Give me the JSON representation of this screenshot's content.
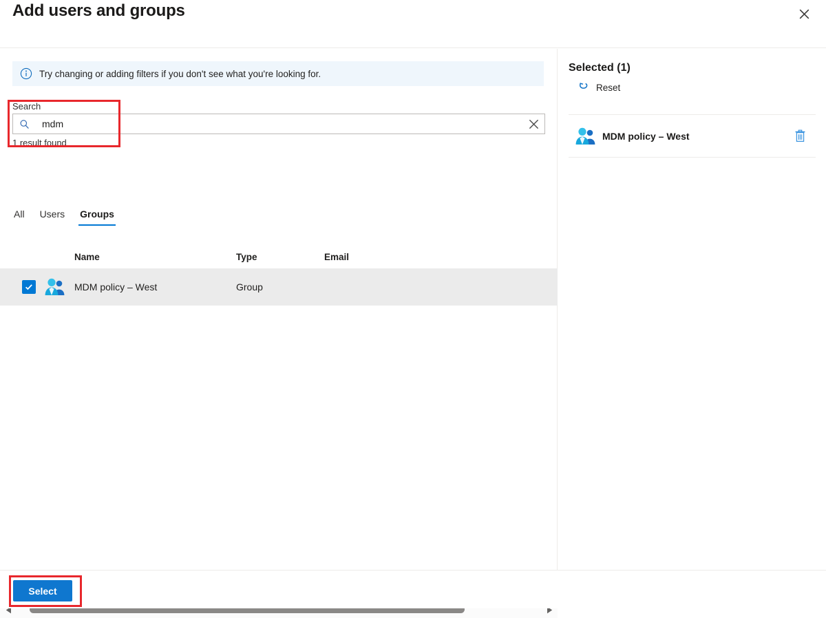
{
  "header": {
    "title": "Add users and groups",
    "close_icon": "close-icon"
  },
  "info_bar": {
    "icon": "info-circle-icon",
    "text": "Try changing or adding filters if you don't see what you're looking for."
  },
  "search": {
    "label": "Search",
    "value": "mdm",
    "placeholder": "",
    "search_icon": "search-icon",
    "clear_icon": "clear-x-icon",
    "result_count_text": "1 result found"
  },
  "tabs": [
    {
      "label": "All",
      "selected": false
    },
    {
      "label": "Users",
      "selected": false
    },
    {
      "label": "Groups",
      "selected": true
    }
  ],
  "table": {
    "columns": [
      "Name",
      "Type",
      "Email"
    ],
    "rows": [
      {
        "checked": true,
        "avatar_icon": "group-people-icon",
        "name": "MDM policy – West",
        "type": "Group",
        "email": ""
      }
    ]
  },
  "scrollbar": {
    "left_arrow_icon": "triangle-left-icon",
    "right_arrow_icon": "triangle-right-icon"
  },
  "selected_panel": {
    "title": "Selected (1)",
    "reset_label": "Reset",
    "reset_icon": "undo-arrow-icon",
    "items": [
      {
        "avatar_icon": "group-people-icon",
        "name": "MDM policy – West",
        "delete_icon": "trash-icon"
      }
    ]
  },
  "footer": {
    "select_label": "Select"
  },
  "colors": {
    "accent": "#0078d4",
    "button_blue": "#0f77cf",
    "info_bar_bg": "#eff6fc",
    "row_selected_bg": "#ebebeb",
    "highlight_red": "#e8272c",
    "divider": "#edebe9",
    "scroll_thumb": "#8a8886"
  }
}
